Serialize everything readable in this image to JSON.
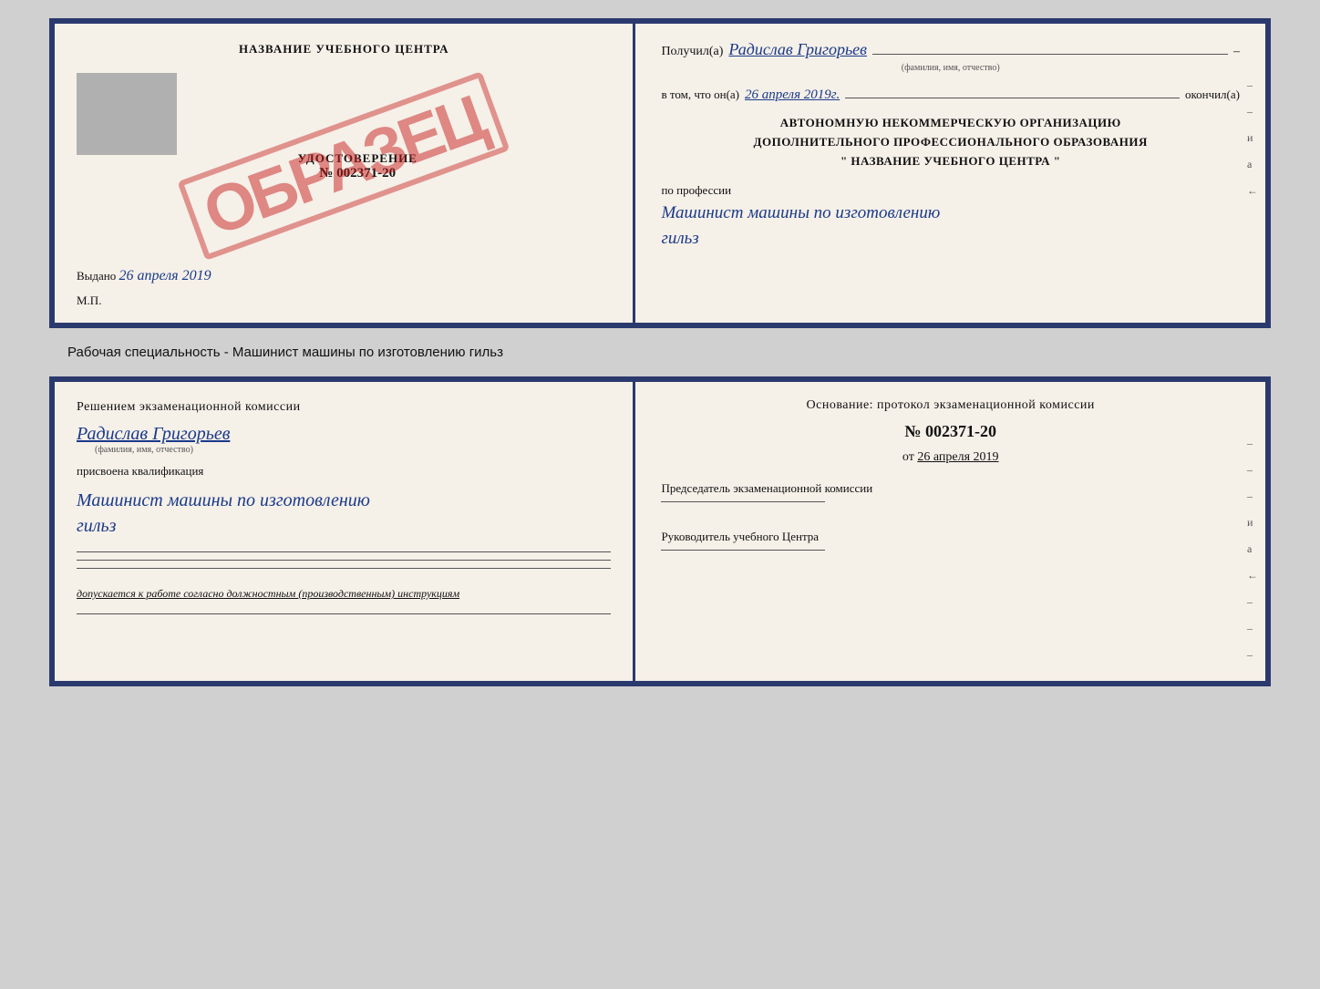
{
  "top_doc": {
    "left": {
      "title": "НАЗВАНИЕ УЧЕБНОГО ЦЕНТРА",
      "cert_label": "УДОСТОВЕРЕНИЕ",
      "cert_number": "№ 002371-20",
      "obrazets": "ОБРАЗЕЦ",
      "vydano": "Выдано",
      "vydano_date": "26 апреля 2019",
      "mp": "М.П."
    },
    "right": {
      "poluchil": "Получил(а)",
      "name_handwritten": "Радислав Григорьев",
      "name_sublabel": "(фамилия, имя, отчество)",
      "dash": "–",
      "vtom_label": "в том, что он(а)",
      "date_handwritten": "26 апреля 2019г.",
      "okonchil": "окончил(а)",
      "org_line1": "АВТОНОМНУЮ НЕКОММЕРЧЕСКУЮ ОРГАНИЗАЦИЮ",
      "org_line2": "ДОПОЛНИТЕЛЬНОГО ПРОФЕССИОНАЛЬНОГО ОБРАЗОВАНИЯ",
      "org_line3": "\"    НАЗВАНИЕ УЧЕБНОГО ЦЕНТРА    \"",
      "po_professii": "по профессии",
      "profession_handwritten": "Машинист машины по изготовлению",
      "profession_handwritten2": "гильз",
      "dashes_right": [
        "–",
        "–",
        "и",
        "а",
        "←"
      ]
    }
  },
  "specialty_label": "Рабочая специальность - Машинист машины по изготовлению гильз",
  "bottom_doc": {
    "left": {
      "resheniem": "Решением  экзаменационной  комиссии",
      "name_handwritten": "Радислав Григорьев",
      "name_sublabel": "(фамилия, имя, отчество)",
      "prisvoena": "присвоена квалификация",
      "qualification_line1": "Машинист  машины  по  изготовлению",
      "qualification_line2": "гильз",
      "dopuskaetsya": "допускается к  работе согласно должностным (производственным) инструкциям"
    },
    "right": {
      "osnovanie": "Основание:  протокол  экзаменационной  комиссии",
      "number": "№  002371-20",
      "ot": "от",
      "date": "26 апреля 2019",
      "predsedatel_label": "Председатель экзаменационной комиссии",
      "rukovoditel_label": "Руководитель учебного Центра",
      "dashes_right": [
        "–",
        "–",
        "–",
        "и",
        "а",
        "←",
        "–",
        "–",
        "–"
      ]
    }
  }
}
